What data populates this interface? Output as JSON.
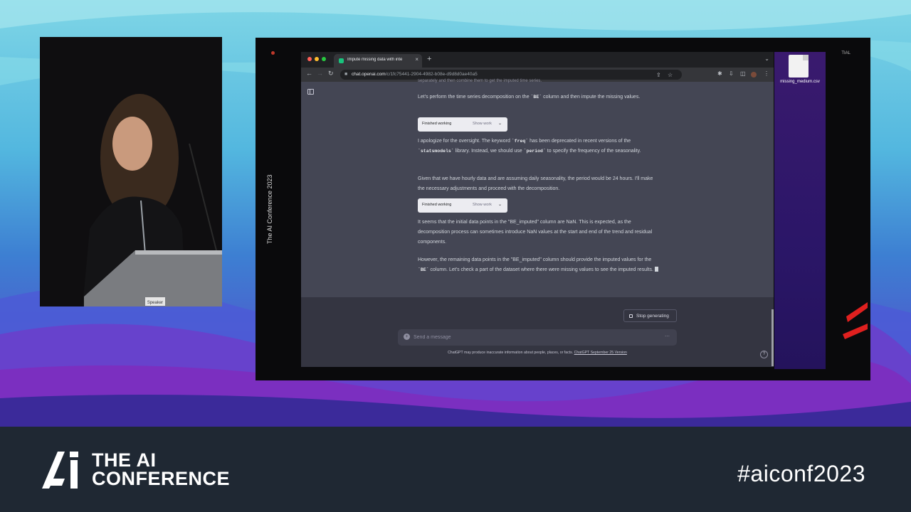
{
  "presentation": {
    "vertical_label": "The AI Conference 2023",
    "desktop_top_right": "TIAL",
    "speaker_badge": "Speaker"
  },
  "desktop": {
    "file_icon": "document-icon",
    "file_label": "missing_medium.csv"
  },
  "browser": {
    "tab_title": "Impute missing data with inte",
    "tab_close": "×",
    "new_tab": "+",
    "url_host": "chat.openai.com",
    "url_path": "/c/1fc75441-2904-4982-b08e-d9d8d0ae40a5"
  },
  "chat": {
    "top_fade": "separately and then combine them to get the imputed time series.",
    "para1": {
      "before": "Let's perform the time series decomposition on the ",
      "code": "`BE`",
      "after": " column and then impute the missing values."
    },
    "work1": {
      "label": "Finished working",
      "action": "Show work"
    },
    "para2": {
      "t1": "I apologize for the oversight. The keyword ",
      "c1": "`freq`",
      "t2": " has been deprecated in recent versions of the ",
      "c2": "`statsmodels`",
      "t3": " library. Instead, we should use ",
      "c3": "`period`",
      "t4": " to specify the frequency of the seasonality."
    },
    "para3": "Given that we have hourly data and are assuming daily seasonality, the period would be 24 hours. I'll make the necessary adjustments and proceed with the decomposition.",
    "work2": {
      "label": "Finished working",
      "action": "Show work"
    },
    "para4": "It seems that the initial data points in the \"BE_imputed\" column are NaN. This is expected, as the decomposition process can sometimes introduce NaN values at the start and end of the trend and residual components.",
    "para5": {
      "before": "However, the remaining data points in the \"BE_imputed\" column should provide the imputed values for the ",
      "code": "`BE`",
      "after": " column. Let's check a part of the dataset where there were missing values to see the imputed results."
    },
    "stop_button": "Stop generating",
    "input_placeholder": "Send a message",
    "disclaimer_text": "ChatGPT may produce inaccurate information about people, places, or facts.",
    "disclaimer_link": "ChatGPT September 25 Version",
    "help": "?"
  },
  "footer": {
    "logo_line1": "THE AI",
    "logo_line2": "CONFERENCE",
    "hashtag": "#aiconf2023"
  },
  "colors": {
    "footer_bg": "#1f2833",
    "chat_bg": "#444654",
    "page_bg": "#343541",
    "accent_green": "#19c37d"
  }
}
